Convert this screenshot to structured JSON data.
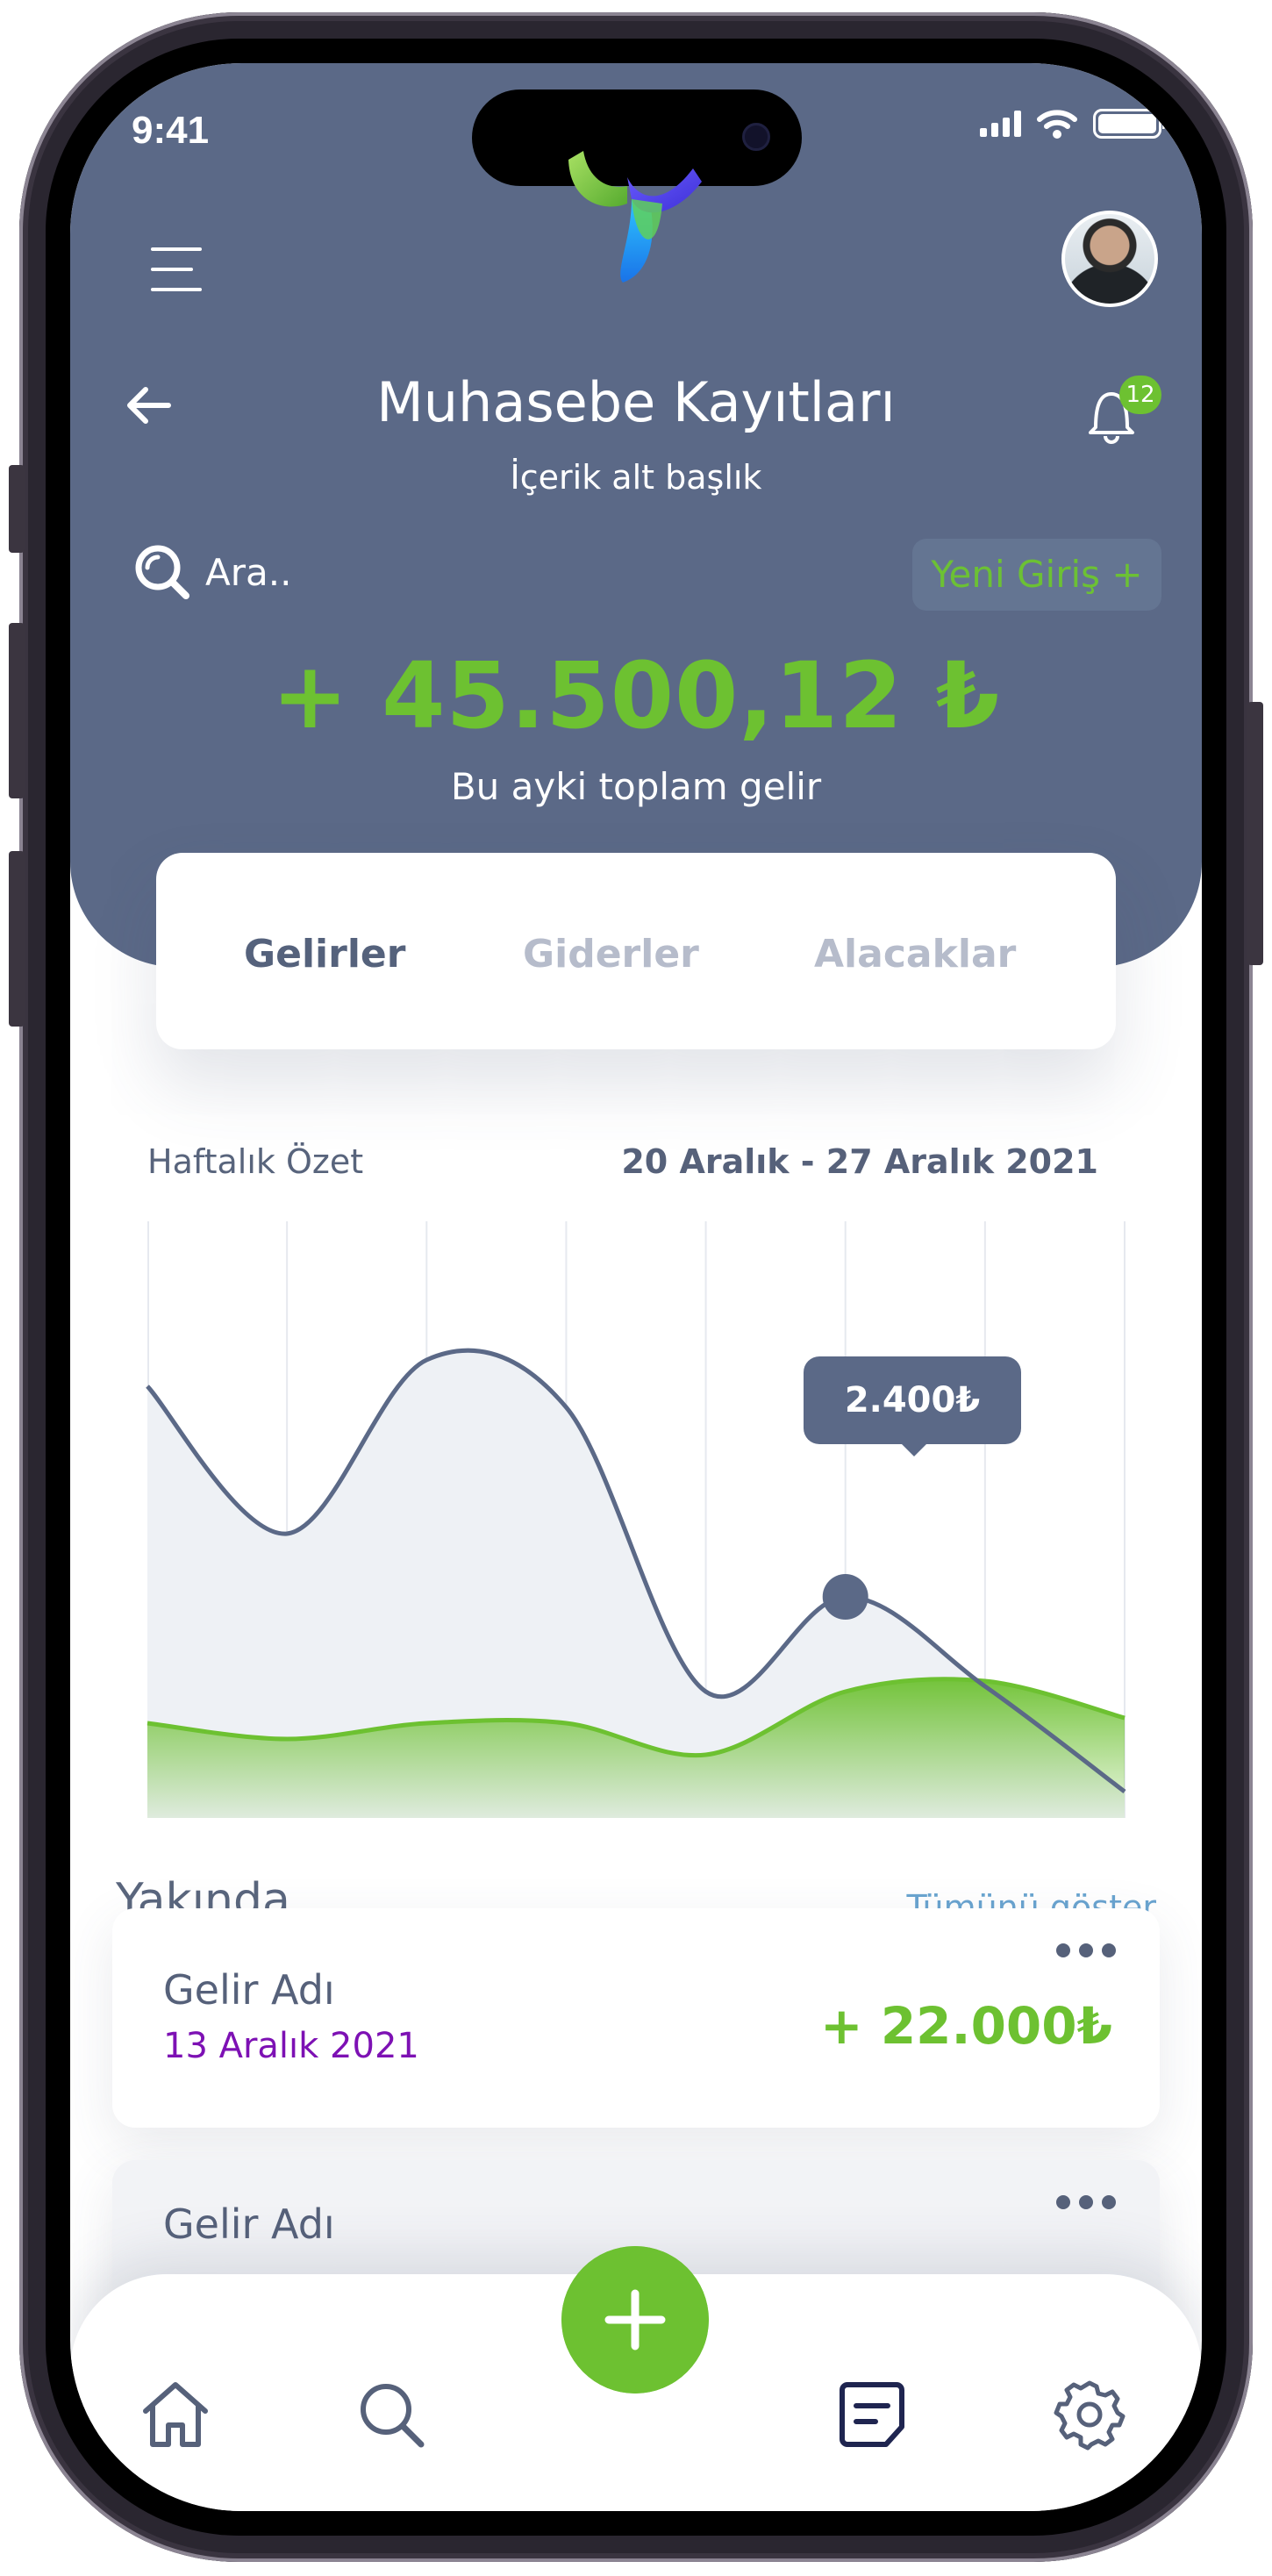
{
  "status_bar": {
    "time": "9:41"
  },
  "header": {
    "title": "Muhasebe Kayıtları",
    "subtitle": "İçerik alt başlık",
    "notification_count": "12",
    "search_placeholder": "Ara..",
    "new_entry_label": "Yeni Giriş +",
    "total_amount": "+ 45.500,12 ₺",
    "total_caption": "Bu ayki toplam gelir"
  },
  "tabs": [
    {
      "label": "Gelirler",
      "active": true
    },
    {
      "label": "Giderler",
      "active": false
    },
    {
      "label": "Alacaklar",
      "active": false
    }
  ],
  "chart_data": {
    "type": "area",
    "title": "Haftalık Özet",
    "subtitle": "20 Aralık - 27 Aralık 2021",
    "x": [
      0,
      1,
      2,
      3,
      4,
      5,
      6,
      7
    ],
    "series": [
      {
        "values": [
          0.82,
          0.54,
          0.87,
          0.78,
          0.24,
          0.42,
          0.25,
          0.05
        ]
      },
      {
        "values": [
          0.18,
          0.15,
          0.18,
          0.18,
          0.12,
          0.24,
          0.26,
          0.19
        ]
      }
    ],
    "highlight": {
      "index": 5,
      "label": "2.400₺"
    },
    "colors": {
      "line": "#5b6987",
      "area": "#6dc131"
    }
  },
  "upcoming": {
    "title": "Yakında",
    "show_all": "Tümünü göster",
    "items": [
      {
        "name": "Gelir Adı",
        "date": "13 Aralık 2021",
        "amount": "+ 22.000₺"
      },
      {
        "name": "Gelir Adı"
      }
    ]
  },
  "nav": {
    "items": [
      "home-icon",
      "search-icon",
      "add-icon",
      "list-icon",
      "settings-icon"
    ],
    "active": "list-icon"
  },
  "colors": {
    "header_bg": "#5b6987",
    "accent": "#6dc131",
    "date": "#7d11b4",
    "link": "#6aa4d0"
  }
}
